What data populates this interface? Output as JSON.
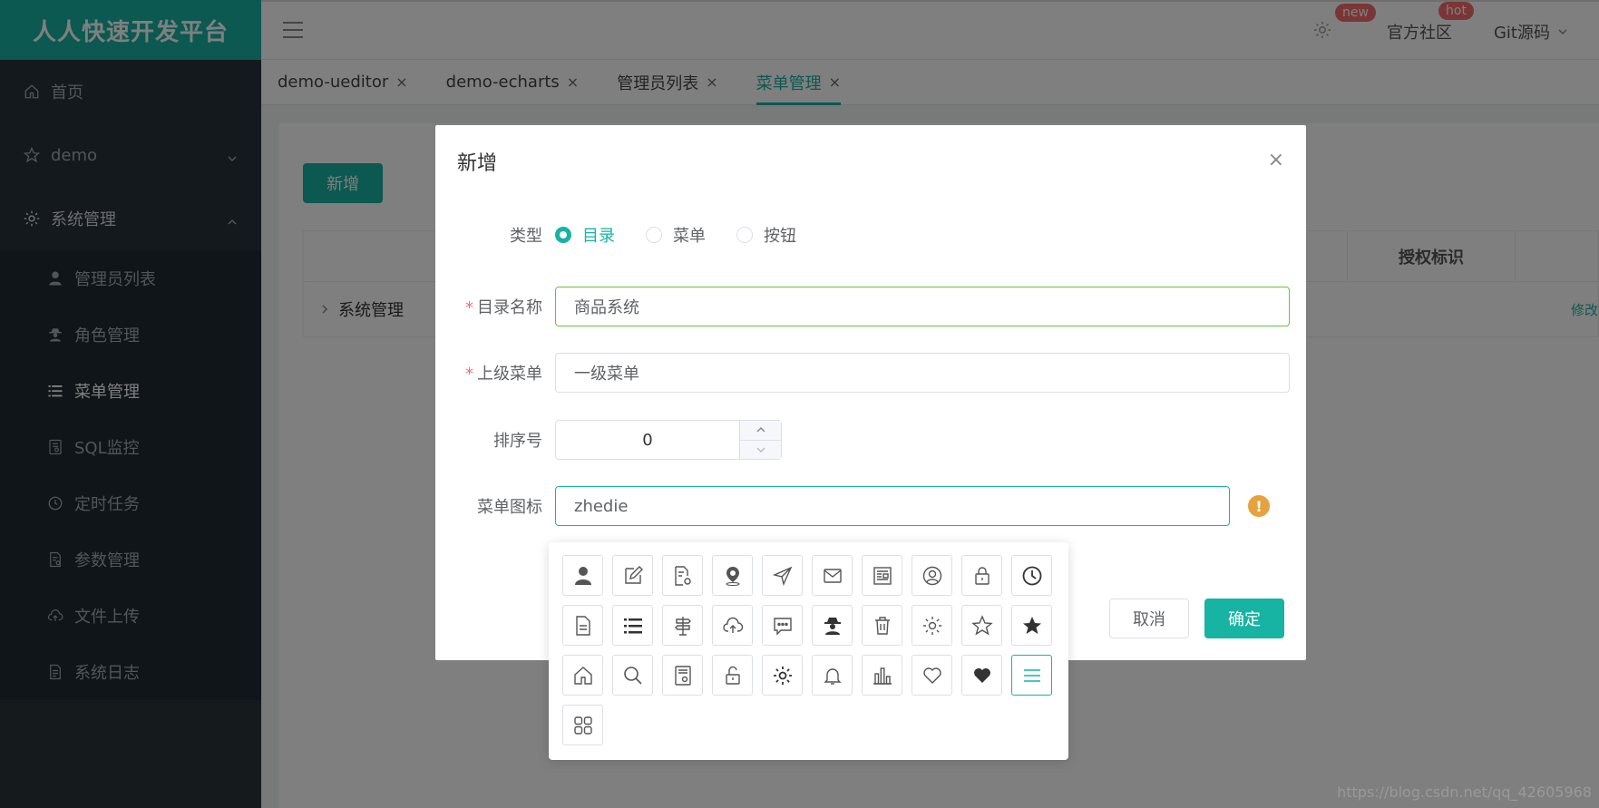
{
  "sidebar": {
    "brand": "人人快速开发平台",
    "items": [
      {
        "label": "首页",
        "icon": "home-icon"
      },
      {
        "label": "demo",
        "icon": "star-icon"
      },
      {
        "label": "系统管理",
        "icon": "gear-icon"
      }
    ],
    "subitems": [
      {
        "label": "管理员列表",
        "icon": "user-icon"
      },
      {
        "label": "角色管理",
        "icon": "spy-icon"
      },
      {
        "label": "菜单管理",
        "icon": "list-icon"
      },
      {
        "label": "SQL监控",
        "icon": "sql-icon"
      },
      {
        "label": "定时任务",
        "icon": "clock-icon"
      },
      {
        "label": "参数管理",
        "icon": "config-icon"
      },
      {
        "label": "文件上传",
        "icon": "cloud-upload-icon"
      },
      {
        "label": "系统日志",
        "icon": "log-icon"
      }
    ]
  },
  "topbar": {
    "badge_new": "new",
    "community": "官方社区",
    "badge_hot": "hot",
    "git": "Git源码"
  },
  "tabs": [
    "demo-ueditor",
    "demo-echarts",
    "管理员列表",
    "菜单管理"
  ],
  "tab_close": "×",
  "main": {
    "add_label": "新增",
    "table_header_auth": "授权标识",
    "row_label": "系统管理",
    "row_edit": "修改"
  },
  "dialog": {
    "title": "新增",
    "close": "×",
    "type_label": "类型",
    "type_options": [
      "目录",
      "菜单",
      "按钮"
    ],
    "name_label": "目录名称",
    "name_value": "商品系统",
    "parent_label": "上级菜单",
    "parent_value": "一级菜单",
    "order_label": "排序号",
    "order_value": "0",
    "icon_label": "菜单图标",
    "icon_value": "zhedie",
    "warn_symbol": "!",
    "cancel": "取消",
    "confirm": "确定"
  },
  "icons": [
    "user-icon",
    "edit-icon",
    "document-settings-icon",
    "location-icon",
    "send-icon",
    "mail-icon",
    "newspaper-icon",
    "user-circle-icon",
    "lock-icon",
    "clock-icon",
    "document-icon",
    "list-icon",
    "signpost-icon",
    "cloud-upload-icon",
    "chat-icon",
    "spy-icon",
    "trash-icon",
    "gear-icon",
    "star-outline-icon",
    "star-filled-icon",
    "home-icon",
    "search-icon",
    "sql-icon",
    "unlock-icon",
    "gear-alt-icon",
    "bell-icon",
    "bar-chart-icon",
    "heart-outline-icon",
    "heart-filled-icon",
    "menu-icon",
    "grid-icon"
  ],
  "selected_icon": "menu-icon",
  "watermark": "https://blog.csdn.net/qq_42605968",
  "colors": {
    "accent": "#17b3a3",
    "sidebar": "#263238",
    "warn": "#e6a23c",
    "badge": "#f56c6c"
  }
}
